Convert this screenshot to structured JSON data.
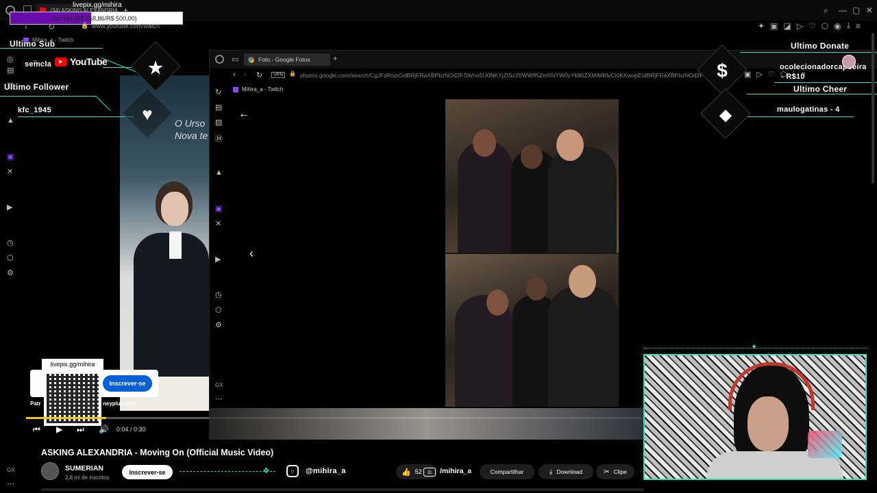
{
  "outer_browser": {
    "tab_title": "(34) ASKING ALEXANDRIA...",
    "address": "www.youtube.com/watch",
    "bookmark": "Mihira_a - Twitch",
    "livepix_top": "livepix.gg/mihira",
    "goal_text": "Contas (R$ 258,86/R$ 500,00)"
  },
  "overlay": {
    "last_sub_label": "Ultimo Sub",
    "last_sub_name": "semcla",
    "last_follower_label": "Ultimo Follower",
    "last_follower_name": "kfc_1945",
    "last_donate_label": "Ultimo Donate",
    "last_donate_name": "ocolecionadorcapoeira",
    "last_donate_amount": "- R$10",
    "last_cheer_label": "Ultimo Cheer",
    "last_cheer_name": "maulogatinas - 4"
  },
  "youtube": {
    "logo_text": "YouTube",
    "video_overlay_text_1": "O Urso",
    "video_overlay_text_2": "Nova te",
    "time": "0:04 / 0:30",
    "sponsor_sub": "Inscrever-se",
    "sponsor_brand_left": "Patr",
    "sponsor_brand_right": "neyplus.com",
    "title": "ASKING ALEXANDRIA - Moving On (Official Music Video)",
    "channel_name": "SUMERIAN",
    "subscribers": "2,8 mi de inscritos",
    "subscribe_label": "Inscrever-se",
    "likes": "52",
    "share_label": "Compartilhar",
    "download_label": "Download",
    "clip_label": "Clipe"
  },
  "livepix_qr": {
    "label": "livepix.gg/mihira"
  },
  "social": {
    "instagram": "@mihira_a",
    "twitch": "/mihira_a"
  },
  "inner_browser": {
    "tab_title": "Foto - Google Fotos",
    "vpn_label": "VPN",
    "address": "photos.google.com/search/CgJFdRopCidBRjFRaXBPbzNOd2FSWno5U0NKYjZlSzZ0WW95Zm5NYW0yYk80ZXMiMRlvCi0KKwopEidBRjFRaXBPbzNOd2F",
    "bookmark": "Mihira_a - Twitch",
    "gx_label": "GX"
  },
  "colors": {
    "accent_teal": "#2fe0c0",
    "youtube_red": "#ff0000",
    "subscribe_blue": "#065fd4",
    "progress_yellow": "#f1c40f"
  },
  "video_progress": 0.13
}
